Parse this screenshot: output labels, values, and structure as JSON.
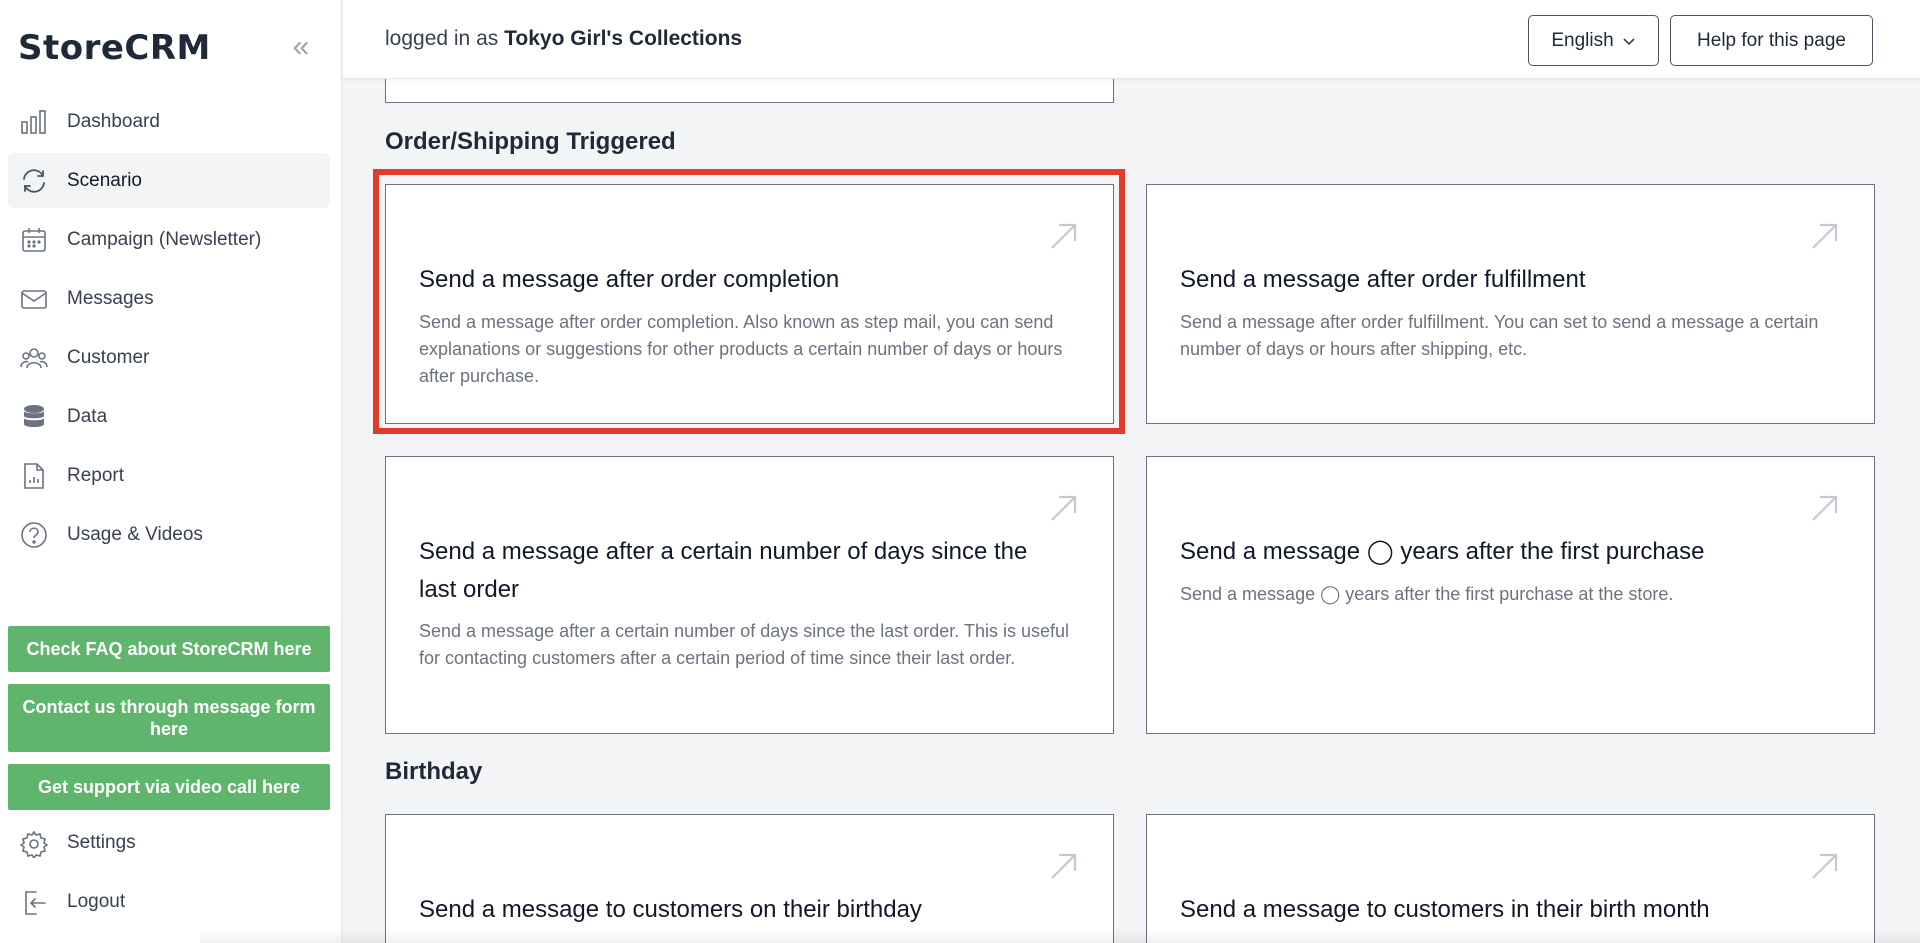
{
  "app": {
    "brand": "StoreCRM"
  },
  "header": {
    "login_prefix": "logged in as",
    "store_name": "Tokyo Girl's Collections",
    "language": "English",
    "help_label": "Help for this page"
  },
  "sidebar": {
    "items": [
      {
        "label": "Dashboard",
        "icon": "bar-chart-icon"
      },
      {
        "label": "Scenario",
        "icon": "refresh-icon",
        "active": true
      },
      {
        "label": "Campaign (Newsletter)",
        "icon": "calendar-icon"
      },
      {
        "label": "Messages",
        "icon": "envelope-icon"
      },
      {
        "label": "Customer",
        "icon": "users-icon"
      },
      {
        "label": "Data",
        "icon": "database-icon"
      },
      {
        "label": "Report",
        "icon": "document-chart-icon"
      },
      {
        "label": "Usage & Videos",
        "icon": "question-circle-icon"
      }
    ],
    "faq_button": "Check FAQ about StoreCRM here",
    "contact_button": "Contact us through message form here",
    "support_button": "Get support via video call here",
    "settings_label": "Settings",
    "logout_label": "Logout"
  },
  "sections": {
    "order_shipping": {
      "title": "Order/Shipping Triggered",
      "cards": [
        {
          "title": "Send a message after order completion",
          "desc": "Send a message after order completion. Also known as step mail, you can send explanations or suggestions for other products a certain number of days or hours after purchase."
        },
        {
          "title": "Send a message after order fulfillment",
          "desc": "Send a message after order fulfillment. You can set to send a message a certain number of days or hours after shipping, etc."
        },
        {
          "title": "Send a message after a certain number of days since the last order",
          "desc": "Send a message after a certain number of days since the last order. This is useful for contacting customers after a certain period of time since their last order."
        },
        {
          "title": "Send a message ◯ years after the first purchase",
          "desc": "Send a message ◯ years after the first purchase at the store."
        }
      ]
    },
    "birthday": {
      "title": "Birthday",
      "cards": [
        {
          "title": "Send a message to customers on their birthday"
        },
        {
          "title": "Send a message to customers in their birth month"
        }
      ]
    }
  },
  "colors": {
    "accent_green": "#5fb56b",
    "highlight_red": "#e23b2a"
  }
}
